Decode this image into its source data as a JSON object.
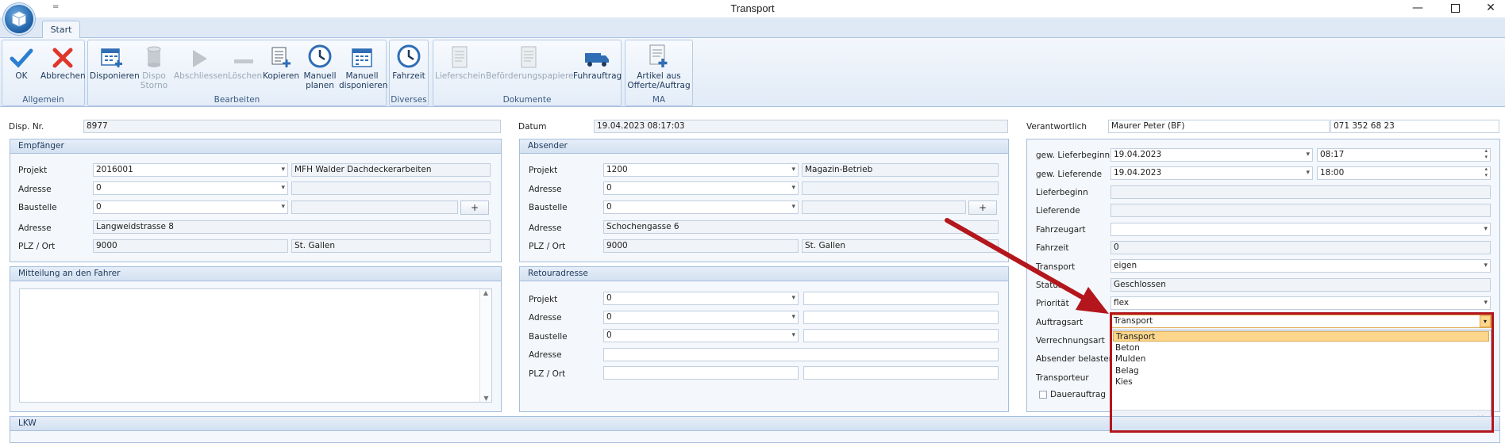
{
  "window": {
    "title": "Transport",
    "qat": "="
  },
  "tabs": [
    {
      "label": "Start"
    }
  ],
  "ribbon": {
    "groups": [
      {
        "caption": "Allgemein",
        "buttons": [
          {
            "label": "OK",
            "icon": "check-icon"
          },
          {
            "label": "Abbrechen",
            "icon": "cross-icon"
          }
        ]
      },
      {
        "caption": "Bearbeiten",
        "buttons": [
          {
            "label": "Disponieren",
            "icon": "calendar-add-icon"
          },
          {
            "label": "Dispo\nStorno",
            "icon": "cylinder-icon",
            "disabled": true
          },
          {
            "label": "Abschliessen",
            "icon": "play-icon",
            "disabled": true
          },
          {
            "label": "Löschen",
            "icon": "minus-icon",
            "disabled": true
          },
          {
            "label": "Kopieren",
            "icon": "copy-icon"
          },
          {
            "label": "Manuell\nplanen",
            "icon": "clock-icon"
          },
          {
            "label": "Manuell\ndisponieren",
            "icon": "calendar-icon"
          }
        ]
      },
      {
        "caption": "Diverses",
        "buttons": [
          {
            "label": "Fahrzeit",
            "icon": "clock-icon"
          }
        ]
      },
      {
        "caption": "Dokumente",
        "buttons": [
          {
            "label": "Lieferschein",
            "icon": "document-icon",
            "disabled": true
          },
          {
            "label": "Beförderungspapiere",
            "icon": "document-icon",
            "disabled": true
          },
          {
            "label": "Fuhrauftrag",
            "icon": "truck-icon"
          }
        ]
      },
      {
        "caption": "MA",
        "buttons": [
          {
            "label": "Artikel aus\nOfferte/Auftrag",
            "icon": "document-add-icon"
          }
        ]
      }
    ]
  },
  "header": {
    "disp_label": "Disp. Nr.",
    "disp_value": "8977",
    "datum_label": "Datum",
    "datum_value": "19.04.2023 08:17:03",
    "verantw_label": "Verantwortlich",
    "verantw_value": "Maurer Peter (BF)",
    "phone": "071 352 68 23"
  },
  "empfaenger": {
    "title": "Empfänger",
    "projekt_label": "Projekt",
    "projekt": "2016001",
    "projekt_name": "MFH Walder Dachdeckerarbeiten",
    "adresse_label": "Adresse",
    "adresse": "0",
    "baustelle_label": "Baustelle",
    "baustelle": "0",
    "adresse2_label": "Adresse",
    "strasse": "Langweidstrasse 8",
    "plz_label": "PLZ / Ort",
    "plz": "9000",
    "ort": "St. Gallen",
    "plus": "+"
  },
  "absender": {
    "title": "Absender",
    "projekt_label": "Projekt",
    "projekt": "1200",
    "projekt_name": "Magazin-Betrieb",
    "adresse_label": "Adresse",
    "adresse": "0",
    "baustelle_label": "Baustelle",
    "baustelle": "0",
    "adresse2_label": "Adresse",
    "strasse": "Schochengasse 6",
    "plz_label": "PLZ / Ort",
    "plz": "9000",
    "ort": "St. Gallen",
    "plus": "+"
  },
  "mitteilung": {
    "title": "Mitteilung an den Fahrer"
  },
  "retour": {
    "title": "Retouradresse",
    "projekt_label": "Projekt",
    "projekt": "0",
    "adresse_label": "Adresse",
    "adresse": "0",
    "baustelle_label": "Baustelle",
    "baustelle": "0",
    "adresse2_label": "Adresse",
    "plz_label": "PLZ / Ort"
  },
  "right": {
    "lieferbeginn_label": "gew. Lieferbeginn",
    "lieferbeginn_date": "19.04.2023",
    "lieferbeginn_time": "08:17",
    "lieferende_label": "gew. Lieferende",
    "lieferende_date": "19.04.2023",
    "lieferende_time": "18:00",
    "lb_label": "Lieferbeginn",
    "le_label": "Lieferende",
    "fahrzeugart_label": "Fahrzeugart",
    "fahrzeit_label": "Fahrzeit",
    "fahrzeit": "0",
    "transport_label": "Transport",
    "transport": "eigen",
    "status_label": "Status",
    "status": "Geschlossen",
    "prio_label": "Priorität",
    "prio": "flex",
    "auftragsart_label": "Auftragsart",
    "auftragsart": "Transport",
    "verrechnung_label": "Verrechnungsart",
    "absender_belasten_label": "Absender belasten",
    "transporteur_label": "Transporteur",
    "dauerauftrag_label": "Dauerauftrag"
  },
  "dropdown": {
    "options": [
      "Transport",
      "Beton",
      "Mulden",
      "Belag",
      "Kies"
    ],
    "selected": "Transport",
    "grip": ":.:.",
    "close": "×"
  },
  "lkw": {
    "title": "LKW"
  },
  "colors": {
    "annotation": "#b3161c",
    "accent": "#1e395b",
    "selection": "#fbd68b"
  }
}
